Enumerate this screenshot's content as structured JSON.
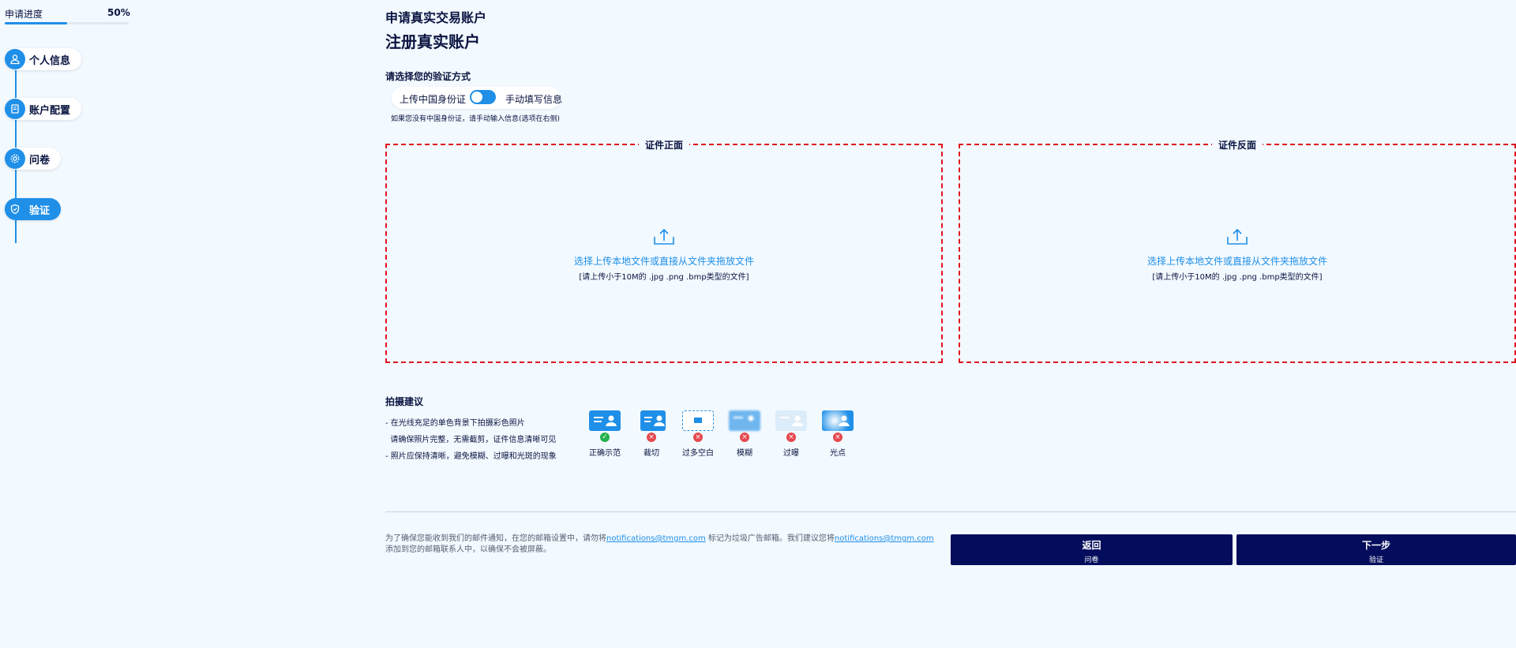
{
  "sidebar": {
    "progress_label": "申请进度",
    "progress_value": "50%",
    "progress_fraction": 0.5,
    "steps": [
      {
        "label": "个人信息",
        "icon": "user-icon"
      },
      {
        "label": "账户配置",
        "icon": "document-icon"
      },
      {
        "label": "问卷",
        "icon": "gear-icon"
      },
      {
        "label": "验证",
        "icon": "shield-icon"
      }
    ]
  },
  "header": {
    "sup_title": "申请真实交易账户",
    "title": "注册真实账户"
  },
  "verification": {
    "label": "请选择您的验证方式",
    "option_left": "上传中国身份证",
    "option_right": "手动填写信息",
    "note": "如果您没有中国身份证，请手动输入信息(选项在右侧)"
  },
  "uploads": [
    {
      "legend": "证件正面",
      "action_text": "选择上传本地文件或直接从文件夹拖放文件",
      "hint": "[请上传小于10M的 .jpg .png .bmp类型的文件]"
    },
    {
      "legend": "证件反面",
      "action_text": "选择上传本地文件或直接从文件夹拖放文件",
      "hint": "[请上传小于10M的 .jpg .png .bmp类型的文件]"
    }
  ],
  "tips": {
    "title": "拍摄建议",
    "lines": [
      "- 在光线充足的单色背景下拍摄彩色照片",
      "  请确保照片完整，无需截剪，证件信息清晰可见",
      "- 照片应保持清晰，避免模糊、过曝和光斑的现象"
    ],
    "samples": [
      {
        "label": "正确示范",
        "status": "ok"
      },
      {
        "label": "裁切",
        "status": "bad"
      },
      {
        "label": "过多空白",
        "status": "bad"
      },
      {
        "label": "模糊",
        "status": "bad"
      },
      {
        "label": "过曝",
        "status": "bad"
      },
      {
        "label": "光点",
        "status": "bad"
      }
    ]
  },
  "footer": {
    "note_part1": "为了确保您能收到我们的邮件通知，在您的邮箱设置中，请勿将",
    "email1": "notifications@tmgm.com",
    "note_part2": " 标记为垃圾广告邮箱。我们建议您将",
    "email2": "notifications@tmgm.com",
    "note_part3": "添加到您的邮箱联系人中，以确保不会被屏蔽。",
    "back_label": "返回",
    "back_sub": "问卷",
    "next_label": "下一步",
    "next_sub": "验证"
  },
  "colors": {
    "accent": "#1f8fe8",
    "navy": "#040d5c",
    "dash": "#e0141e",
    "ok": "#22b14c",
    "bad": "#e5484d",
    "background": "#f2f9ff"
  }
}
